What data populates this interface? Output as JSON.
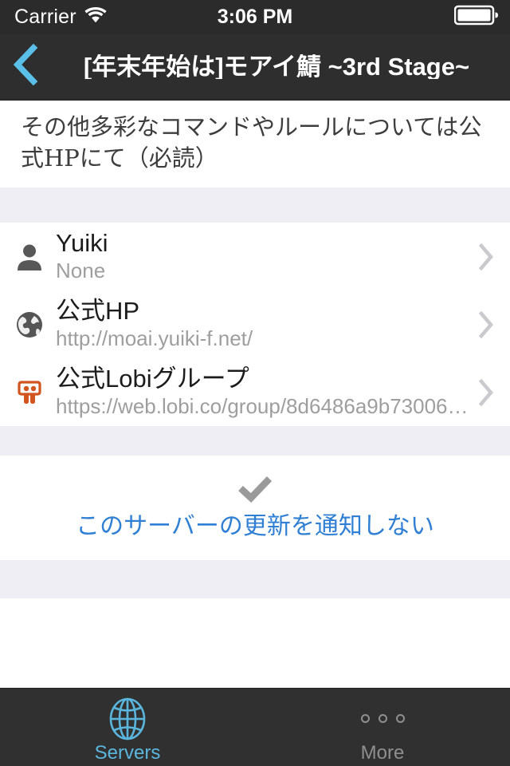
{
  "statusbar": {
    "carrier": "Carrier",
    "wifi_icon": "wifi-icon",
    "time": "3:06 PM",
    "battery_icon": "battery-full-icon"
  },
  "navbar": {
    "back_icon": "chevron-left-icon",
    "title": "[年末年始は]モアイ鯖 ~3rd Stage~",
    "background_color": "#2e2e2e",
    "accent_color": "#5bc0e8"
  },
  "description": {
    "text": "その他多彩なコマンドやルールについては公式HPにて（必読）"
  },
  "info_list": {
    "rows": [
      {
        "icon": "person-icon",
        "title": "Yuiki",
        "subtitle": "None",
        "chevron": "chevron-right-icon"
      },
      {
        "icon": "globe-icon",
        "title": "公式HP",
        "subtitle": "http://moai.yuiki-f.net/",
        "chevron": "chevron-right-icon"
      },
      {
        "icon": "lobi-icon",
        "title": "公式Lobiグループ",
        "subtitle": "https://web.lobi.co/group/8d6486a9b73006…",
        "chevron": "chevron-right-icon"
      }
    ]
  },
  "notify": {
    "check_icon": "checkmark-icon",
    "check_color": "#9a9a9a",
    "label": "このサーバーの更新を通知しない",
    "label_color": "#2f7fd4"
  },
  "tabbar": {
    "tabs": [
      {
        "icon": "globe-icon",
        "label": "Servers",
        "active": true,
        "color": "#5bb6de"
      },
      {
        "icon": "more-dots-icon",
        "label": "More",
        "active": false,
        "color": "#8f8f8f"
      }
    ]
  },
  "colors": {
    "section_gap": "#efeef4",
    "row_background": "#ffffff",
    "lobi_orange": "#d2541e"
  }
}
